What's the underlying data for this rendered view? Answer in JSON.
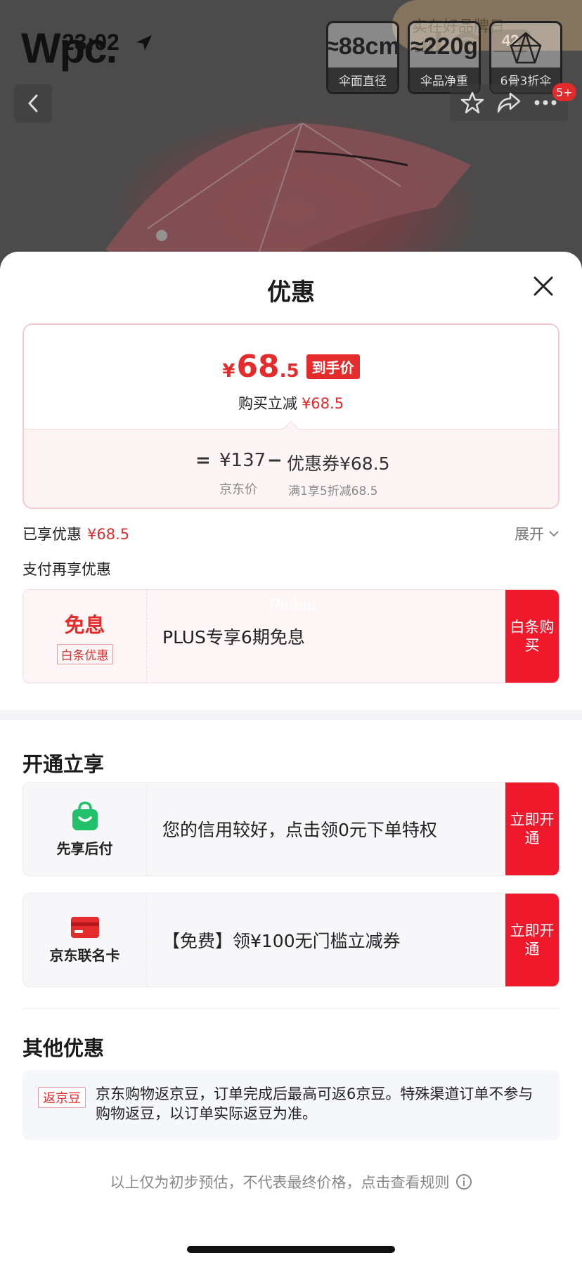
{
  "background": {
    "brand_logo": "Wpc.",
    "status": {
      "time": "23:02",
      "battery": "42"
    },
    "corner_badge": "实在好品牌日",
    "specs": [
      {
        "value": "≈88cm",
        "label": "伞面直径"
      },
      {
        "value": "≈220g",
        "label": "伞品净重"
      },
      {
        "value": "",
        "label": "6骨3折伞"
      }
    ],
    "cart_badge": "5+"
  },
  "sheet": {
    "title": "优惠",
    "price_card": {
      "yen": "¥",
      "price_int": "68",
      "price_dec": ".5",
      "price_tag": "到手价",
      "direct_discount_label": "购买立减",
      "direct_discount_value": "¥68.5",
      "calc_eq": "=",
      "calc_price": "¥137",
      "calc_minus": "−",
      "calc_coupon": "优惠券¥68.5",
      "calc_price_caption": "京东价",
      "calc_coupon_caption": "满1享5折减68.5"
    },
    "enjoyed_label": "已享优惠",
    "enjoyed_value": "¥68.5",
    "expand_label": "展开",
    "pay_more_label": "支付再享优惠",
    "baitiao_offer": {
      "title": "免息",
      "subtitle": "白条优惠",
      "text": "PLUS专享6期免息",
      "button": "白条购买",
      "watermark": "Piubiu"
    },
    "open_section_title": "开通立享",
    "xianxiang_offer": {
      "label": "先享后付",
      "text": "您的信用较好，点击领0元下单特权",
      "button": "立即开通"
    },
    "lianming_offer": {
      "label": "京东联名卡",
      "text": "【免费】领¥100无门槛立减券",
      "button": "立即开通"
    },
    "other_section_title": "其他优惠",
    "jingdou": {
      "tag": "返京豆",
      "text": "京东购物返京豆，订单完成后最高可返6京豆。特殊渠道订单不参与购物返豆，以订单实际返豆为准。"
    },
    "footer_note": "以上仅为初步预估，不代表最终价格，点击查看规则"
  },
  "colors": {
    "accent": "#e42c2c",
    "button_red": "#f0192b",
    "green": "#21c16b"
  }
}
